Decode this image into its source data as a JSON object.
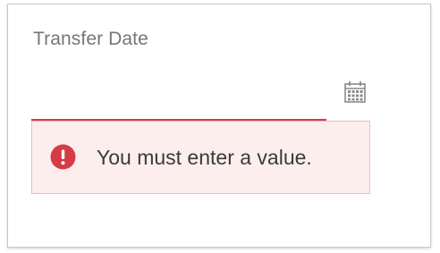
{
  "field": {
    "label": "Transfer Date",
    "value": "",
    "calendar_icon": "calendar-icon",
    "error_icon": "error-exclamation-icon",
    "error_message": "You must enter a value."
  },
  "colors": {
    "error_accent": "#d63b48",
    "error_background": "#fdeeee",
    "error_border": "#f3b9bc",
    "label_text": "#767676",
    "message_text": "#3a3a3a",
    "icon_gray": "#8a8a8a"
  }
}
